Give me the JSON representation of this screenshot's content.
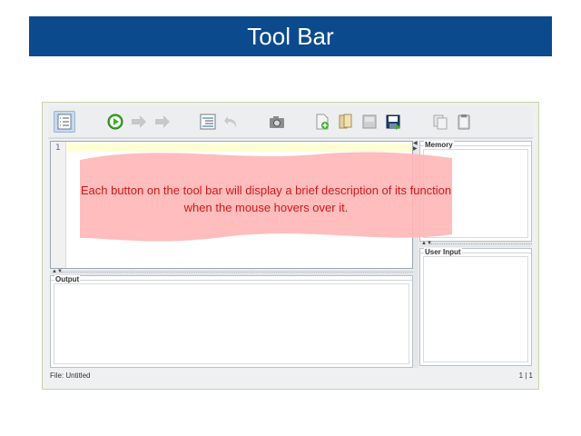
{
  "slide": {
    "title": "Tool Bar"
  },
  "editor": {
    "line_number": "1"
  },
  "panels": {
    "output": "Output",
    "memory": "Memory",
    "user_input": "User Input"
  },
  "status": {
    "file": "File: Untitled",
    "position": "1 | 1"
  },
  "callout": {
    "text": "Each button on the tool bar will display a brief description of its function when the mouse hovers over it."
  },
  "toolbar": {
    "buttons": [
      {
        "icon": "line-numbers-icon",
        "active": true
      },
      {
        "icon": "run-icon"
      },
      {
        "icon": "step-icon"
      },
      {
        "icon": "step-over-icon"
      },
      {
        "icon": "format-icon"
      },
      {
        "icon": "undo-icon"
      },
      {
        "icon": "screenshot-icon"
      },
      {
        "icon": "new-file-icon"
      },
      {
        "icon": "open-file-icon"
      },
      {
        "icon": "save-icon"
      },
      {
        "icon": "save-as-icon"
      },
      {
        "icon": "copy-icon"
      },
      {
        "icon": "paste-icon"
      }
    ]
  },
  "colors": {
    "title_bg": "#0b4a8c",
    "callout_fill": "#ffb6b6",
    "callout_text": "#d01818"
  }
}
